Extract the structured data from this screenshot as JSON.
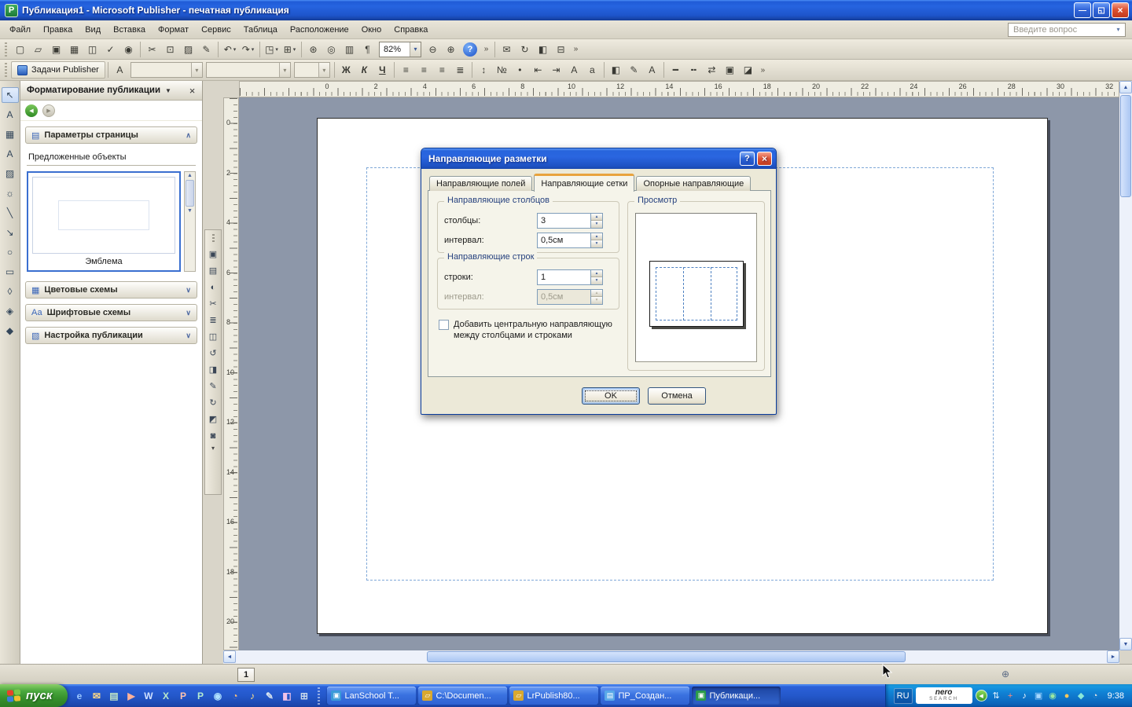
{
  "titlebar": {
    "title": "Публикация1 - Microsoft Publisher - печатная публикация",
    "app_icon_letter": "P",
    "minimize_glyph": "—",
    "restore_glyph": "◱",
    "close_glyph": "×"
  },
  "menubar": {
    "items": [
      {
        "name": "menu-file",
        "label": "Файл"
      },
      {
        "name": "menu-edit",
        "label": "Правка"
      },
      {
        "name": "menu-view",
        "label": "Вид"
      },
      {
        "name": "menu-insert",
        "label": "Вставка"
      },
      {
        "name": "menu-format",
        "label": "Формат"
      },
      {
        "name": "menu-tools",
        "label": "Сервис"
      },
      {
        "name": "menu-table",
        "label": "Таблица"
      },
      {
        "name": "menu-arrange",
        "label": "Расположение"
      },
      {
        "name": "menu-window",
        "label": "Окно"
      },
      {
        "name": "menu-help",
        "label": "Справка"
      }
    ],
    "ask": "Введите вопрос"
  },
  "standard_toolbar": {
    "file_icons": [
      {
        "name": "new-document-icon",
        "glyph": "▢"
      },
      {
        "name": "open-icon",
        "glyph": "▱"
      },
      {
        "name": "save-icon",
        "glyph": "▣"
      },
      {
        "name": "print-icon",
        "glyph": "▦"
      },
      {
        "name": "print-preview-icon",
        "glyph": "◫"
      },
      {
        "name": "spelling-icon",
        "glyph": "✓"
      },
      {
        "name": "research-icon",
        "glyph": "◉"
      }
    ],
    "clipboard_icons": [
      {
        "name": "cut-icon",
        "glyph": "✂"
      },
      {
        "name": "copy-icon",
        "glyph": "⊡"
      },
      {
        "name": "paste-icon",
        "glyph": "▨"
      },
      {
        "name": "format-painter-icon",
        "glyph": "✎"
      }
    ],
    "undo_icons": [
      {
        "name": "undo-icon",
        "glyph": "↶",
        "dropdown": true
      },
      {
        "name": "redo-icon",
        "glyph": "↷",
        "dropdown": true
      }
    ],
    "arrange_icons": [
      {
        "name": "bring-to-front-icon",
        "glyph": "◳",
        "dropdown": true
      },
      {
        "name": "align-objects-icon",
        "glyph": "⊞",
        "dropdown": true
      }
    ],
    "web_icons": [
      {
        "name": "insert-hyperlink-icon",
        "glyph": "⊛"
      },
      {
        "name": "zoom-page-icon",
        "glyph": "◎"
      },
      {
        "name": "columns-icon",
        "glyph": "▥"
      },
      {
        "name": "special-characters-icon",
        "glyph": "¶"
      }
    ],
    "zoom_value": "82%",
    "zoom_icons": [
      {
        "name": "zoom-out-icon",
        "glyph": "⊖"
      },
      {
        "name": "zoom-in-icon",
        "glyph": "⊕"
      }
    ],
    "help_glyph": "?",
    "extra_icons": [
      {
        "name": "send-email-icon",
        "glyph": "✉"
      },
      {
        "name": "rotate-icon",
        "glyph": "↻"
      },
      {
        "name": "boundaries-icon",
        "glyph": "◧"
      },
      {
        "name": "measurement-icon",
        "glyph": "⊟"
      }
    ],
    "options_glyph": "»"
  },
  "formatting_toolbar": {
    "tasks_label": "Задачи Publisher",
    "styles_glyph": "А",
    "bold_glyph": "Ж",
    "italic_glyph": "К",
    "underline_glyph": "Ч",
    "align_icons": [
      {
        "name": "align-left-icon",
        "glyph": "≡"
      },
      {
        "name": "align-center-icon",
        "glyph": "≡"
      },
      {
        "name": "align-right-icon",
        "glyph": "≡"
      },
      {
        "name": "align-justify-icon",
        "glyph": "≣"
      }
    ],
    "para_icons": [
      {
        "name": "line-spacing-icon",
        "glyph": "↕"
      },
      {
        "name": "numbering-icon",
        "glyph": "№"
      },
      {
        "name": "bullets-icon",
        "glyph": "•"
      },
      {
        "name": "decrease-indent-icon",
        "glyph": "⇤"
      },
      {
        "name": "increase-indent-icon",
        "glyph": "⇥"
      },
      {
        "name": "increase-font-icon",
        "glyph": "A"
      },
      {
        "name": "decrease-font-icon",
        "glyph": "a"
      }
    ],
    "color_icons": [
      {
        "name": "fill-color-icon",
        "glyph": "◧"
      },
      {
        "name": "line-color-icon",
        "glyph": "✎"
      },
      {
        "name": "font-color-icon",
        "glyph": "А"
      }
    ],
    "effect_icons": [
      {
        "name": "line-style-icon",
        "glyph": "━"
      },
      {
        "name": "dash-style-icon",
        "glyph": "╍"
      },
      {
        "name": "arrow-style-icon",
        "glyph": "⇄"
      },
      {
        "name": "shadow-style-icon",
        "glyph": "▣"
      },
      {
        "name": "3d-style-icon",
        "glyph": "◪"
      }
    ],
    "options_glyph": "»"
  },
  "toolbox": {
    "items": [
      {
        "name": "select-tool",
        "glyph": "↖"
      },
      {
        "name": "text-box-tool",
        "glyph": "A"
      },
      {
        "name": "table-tool",
        "glyph": "▦"
      },
      {
        "name": "wordart-tool",
        "glyph": "А"
      },
      {
        "name": "picture-frame-tool",
        "glyph": "▨"
      },
      {
        "name": "clip-art-tool",
        "glyph": "☼"
      },
      {
        "name": "line-tool",
        "glyph": "╲"
      },
      {
        "name": "arrow-tool",
        "glyph": "↘"
      },
      {
        "name": "oval-tool",
        "glyph": "○"
      },
      {
        "name": "rectangle-tool",
        "glyph": "▭"
      },
      {
        "name": "autoshapes-tool",
        "glyph": "◊"
      },
      {
        "name": "hotspot-tool",
        "glyph": "◈"
      },
      {
        "name": "design-gallery-tool",
        "glyph": "◆"
      }
    ]
  },
  "picture_toolbar": {
    "items": [
      {
        "name": "insert-picture-icon",
        "glyph": "▣"
      },
      {
        "name": "picture-from-file-icon",
        "glyph": "▤"
      },
      {
        "name": "color-mode-icon",
        "glyph": "◐"
      },
      {
        "name": "crop-icon",
        "glyph": "✂"
      },
      {
        "name": "line-style-icon",
        "glyph": "≣"
      },
      {
        "name": "text-wrapping-icon",
        "glyph": "◫"
      },
      {
        "name": "rotate-left-icon",
        "glyph": "↺"
      },
      {
        "name": "transparent-color-icon",
        "glyph": "◨"
      },
      {
        "name": "format-picture-icon",
        "glyph": "✎"
      },
      {
        "name": "reset-picture-icon",
        "glyph": "↻"
      },
      {
        "name": "compress-pictures-icon",
        "glyph": "◩"
      },
      {
        "name": "picture-fill-icon",
        "glyph": "◙"
      }
    ],
    "more_glyph": "▾"
  },
  "taskpane": {
    "title": "Форматирование публикации",
    "menu_arrow_glyph": "▼",
    "close_glyph": "×",
    "back_glyph": "◀",
    "forward_glyph": "▶",
    "suggested_label": "Предложенные объекты",
    "item_caption": "Эмблема",
    "scroll_up_glyph": "▲",
    "scroll_down_glyph": "▼",
    "sections": [
      {
        "label": "Параметры страницы",
        "icon": "▤",
        "chevron": "∧"
      },
      {
        "label": "Цветовые схемы",
        "icon": "▦",
        "chevron": "∨"
      },
      {
        "label": "Шрифтовые схемы",
        "icon": "Аа",
        "chevron": "∨"
      },
      {
        "label": "Настройка публикации",
        "icon": "▧",
        "chevron": "∨"
      }
    ]
  },
  "rulers": {
    "horizontal": [
      "0",
      "2",
      "4",
      "6",
      "8",
      "10",
      "12",
      "14",
      "16",
      "18",
      "20",
      "22",
      "24",
      "26",
      "28",
      "30",
      "32"
    ],
    "vertical": [
      "0",
      "2",
      "4",
      "6",
      "8",
      "10",
      "12",
      "14",
      "16",
      "18",
      "20"
    ]
  },
  "dialog": {
    "title": "Направляющие разметки",
    "help_glyph": "?",
    "close_glyph": "×",
    "tabs": [
      {
        "name": "tab-margin-guides",
        "label": "Направляющие полей"
      },
      {
        "name": "tab-grid-guides",
        "label": "Направляющие сетки",
        "active": true
      },
      {
        "name": "tab-baseline-guides",
        "label": "Опорные направляющие"
      }
    ],
    "columns_group": {
      "legend": "Направляющие столбцов",
      "rows": [
        {
          "name": "columns-field",
          "label": "столбцы:",
          "value": "3"
        },
        {
          "name": "column-spacing-field",
          "label": "интервал:",
          "value": "0,5см"
        }
      ]
    },
    "rows_group": {
      "legend": "Направляющие строк",
      "rows": [
        {
          "name": "rows-field",
          "label": "строки:",
          "value": "1"
        },
        {
          "name": "row-spacing-field",
          "label": "интервал:",
          "value": "0,5см",
          "disabled": true
        }
      ]
    },
    "checkbox_label": "Добавить центральную направляющую между столбцами и строками",
    "preview_legend": "Просмотр",
    "ok_label": "OK",
    "cancel_label": "Отмена"
  },
  "pager": {
    "page": "1"
  },
  "status": {
    "position_glyph": "⊕"
  },
  "taskbar": {
    "start_label": "пуск",
    "quick_launch": [
      {
        "name": "ql-internet-explorer-icon",
        "glyph": "e",
        "color": "#9cc8ff"
      },
      {
        "name": "ql-outlook-icon",
        "glyph": "✉",
        "color": "#ffd986"
      },
      {
        "name": "ql-show-desktop-icon",
        "glyph": "▤",
        "color": "#bfe3c5"
      },
      {
        "name": "ql-media-player-icon",
        "glyph": "▶",
        "color": "#ffb199"
      },
      {
        "name": "ql-word-icon",
        "glyph": "W",
        "color": "#cfe0ff"
      },
      {
        "name": "ql-excel-icon",
        "glyph": "X",
        "color": "#b9e8c9"
      },
      {
        "name": "ql-powerpoint-icon",
        "glyph": "P",
        "color": "#ffc4ae"
      },
      {
        "name": "ql-publisher-icon",
        "glyph": "P",
        "color": "#b5ecd0"
      },
      {
        "name": "ql-messenger-icon",
        "glyph": "◉",
        "color": "#aee0ff"
      },
      {
        "name": "ql-firefox-icon",
        "glyph": "◔",
        "color": "#ffc078"
      },
      {
        "name": "ql-media-icon",
        "glyph": "♪",
        "color": "#ffe08a"
      },
      {
        "name": "ql-notepad-icon",
        "glyph": "✎",
        "color": "#d8e4f0"
      },
      {
        "name": "ql-paint-icon",
        "glyph": "◧",
        "color": "#f0c2e8"
      },
      {
        "name": "ql-calculator-icon",
        "glyph": "⊞",
        "color": "#c8d8ea"
      }
    ],
    "tasks": [
      {
        "name": "task-lanschool",
        "label": "LanSchool T...",
        "glyph": "▣",
        "color": "#3a9ad8"
      },
      {
        "name": "task-documents",
        "label": "C:\\Documen...",
        "glyph": "▱",
        "color": "#d8a830"
      },
      {
        "name": "task-lrpublish",
        "label": "LrPublish80...",
        "glyph": "▱",
        "color": "#d8a830"
      },
      {
        "name": "task-pr-sozdan",
        "label": "ПР_Создан...",
        "glyph": "▤",
        "color": "#58a8e8"
      },
      {
        "name": "task-publication",
        "label": "Публикаци...",
        "glyph": "▣",
        "color": "#2a9a4a",
        "active": true
      }
    ],
    "language": "RU",
    "nero_top": "nero",
    "nero_bottom": "SEARCH",
    "chevron_glyph": "◀",
    "tray_icons": [
      {
        "name": "tray-network-icon",
        "glyph": "⇅",
        "color": "#e8f4ff"
      },
      {
        "name": "tray-antivirus-icon",
        "glyph": "+",
        "color": "#ff8a7a"
      },
      {
        "name": "tray-volume-icon",
        "glyph": "♪",
        "color": "#ffffff"
      },
      {
        "name": "tray-display-icon",
        "glyph": "▣",
        "color": "#a8d8ff"
      },
      {
        "name": "tray-messenger-icon",
        "glyph": "◉",
        "color": "#9ae8a0"
      },
      {
        "name": "tray-update-icon",
        "glyph": "●",
        "color": "#ffc858"
      },
      {
        "name": "tray-safely-remove-icon",
        "glyph": "◆",
        "color": "#8ae8d8"
      },
      {
        "name": "tray-clock-sync-icon",
        "glyph": "◔",
        "color": "#e0e0e0"
      }
    ],
    "time": "9:38"
  }
}
